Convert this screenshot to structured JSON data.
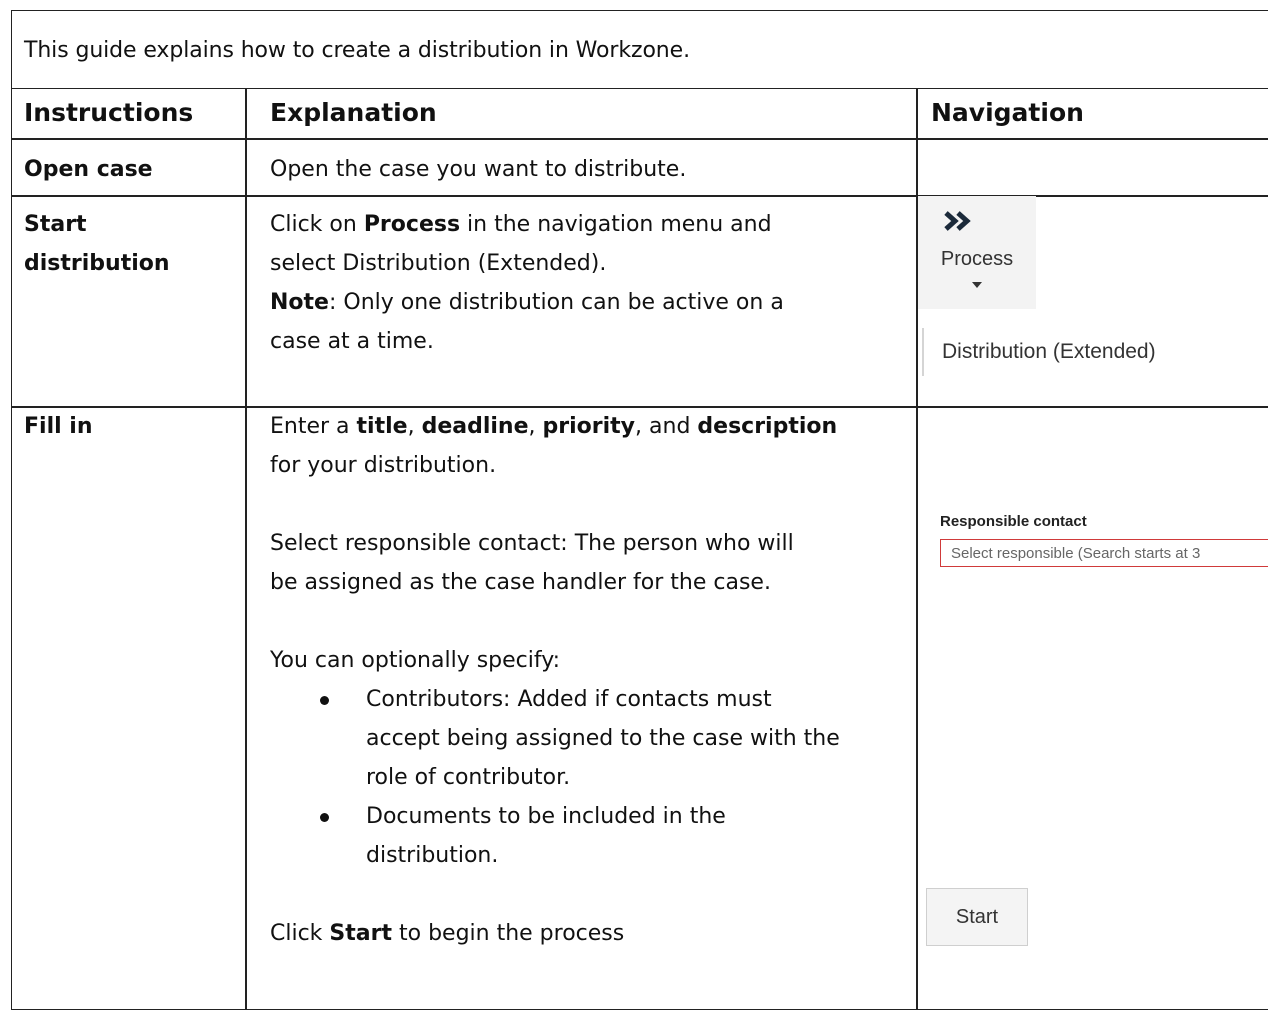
{
  "intro": "This guide explains how to create a distribution in Workzone.",
  "headers": {
    "instructions": "Instructions",
    "explanation": "Explanation",
    "navigation": "Navigation"
  },
  "rows": {
    "open_case": {
      "instruction": "Open case",
      "explanation": "Open the case you want to distribute."
    },
    "start_distribution": {
      "instruction_line1": "Start",
      "instruction_line2": "distribution",
      "exp_line1_pre": "Click on ",
      "exp_line1_bold": "Process",
      "exp_line1_post": " in the navigation menu and",
      "exp_line2": "select Distribution (Extended).",
      "note_bold": "Note",
      "note_line1_post": ": Only one distribution can be active on a",
      "note_line2": "case at a time."
    },
    "fill_in": {
      "instruction": "Fill in",
      "enter_a": "Enter a ",
      "title": "title",
      "comma1": ", ",
      "deadline": "deadline",
      "comma2": ", ",
      "priority": "priority",
      "and": ", and ",
      "description": "description",
      "line2": "for your distribution.",
      "responsible_line1": "Select responsible contact: The person who will",
      "responsible_line2": "be assigned as the case handler for the case.",
      "optional_intro": "You can optionally specify:",
      "bullets": [
        {
          "line1": "Contributors: Added if contacts must",
          "line2": "accept being assigned to the case with the",
          "line3": "role of contributor."
        },
        {
          "line1": "Documents to be included in the",
          "line2": "distribution."
        }
      ],
      "click_pre": "Click ",
      "click_bold": "Start",
      "click_post": " to begin the process"
    }
  },
  "navigation": {
    "process_icon": "double-chevron-right-icon",
    "process_label": "Process",
    "distribution_menu_item": "Distribution (Extended)",
    "responsible_label": "Responsible contact",
    "responsible_placeholder": "Select responsible (Search starts at 3",
    "start_button": "Start"
  },
  "colors": {
    "border": "#222222",
    "input_error_border": "#d03a3a",
    "widget_bg": "#f3f3f3",
    "chevron": "#1b2a3a"
  }
}
